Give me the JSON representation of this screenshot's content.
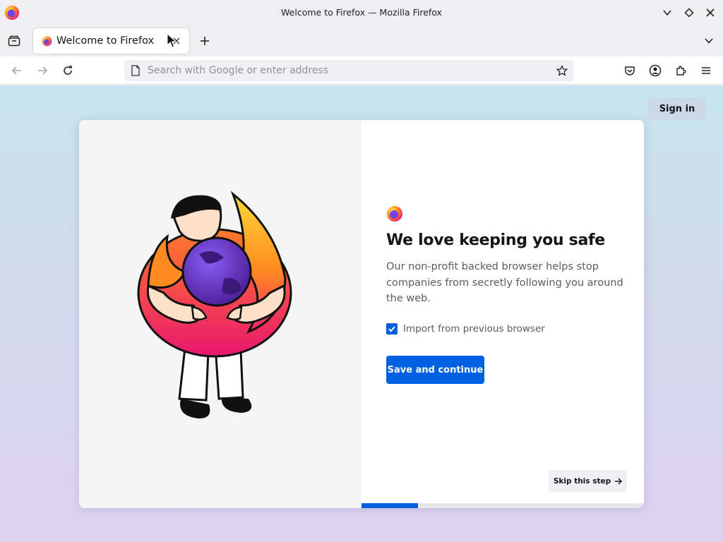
{
  "window": {
    "title": "Welcome to Firefox — Mozilla Firefox"
  },
  "tabs": [
    {
      "label": "Welcome to Firefox",
      "active": true
    }
  ],
  "urlbar": {
    "value": "",
    "placeholder": "Search with Google or enter address"
  },
  "toolbar_icons": [
    "pocket-icon",
    "account-icon",
    "extensions-icon",
    "menu-icon"
  ],
  "page": {
    "sign_in_label": "Sign in",
    "heading": "We love keeping you safe",
    "description": "Our non-profit backed browser helps stop companies from secretly following you around the web.",
    "import_checkbox": {
      "label": "Import from previous browser",
      "checked": true
    },
    "primary_button": "Save and continue",
    "skip_button": "Skip this step",
    "progress": {
      "current_step": 1,
      "total_steps": 5
    }
  },
  "colors": {
    "accent": "#0061e0",
    "gradient_top": "#c6e4ee",
    "gradient_bottom": "#ddd2f2",
    "sign_in_bg": "#cbd9e6"
  }
}
